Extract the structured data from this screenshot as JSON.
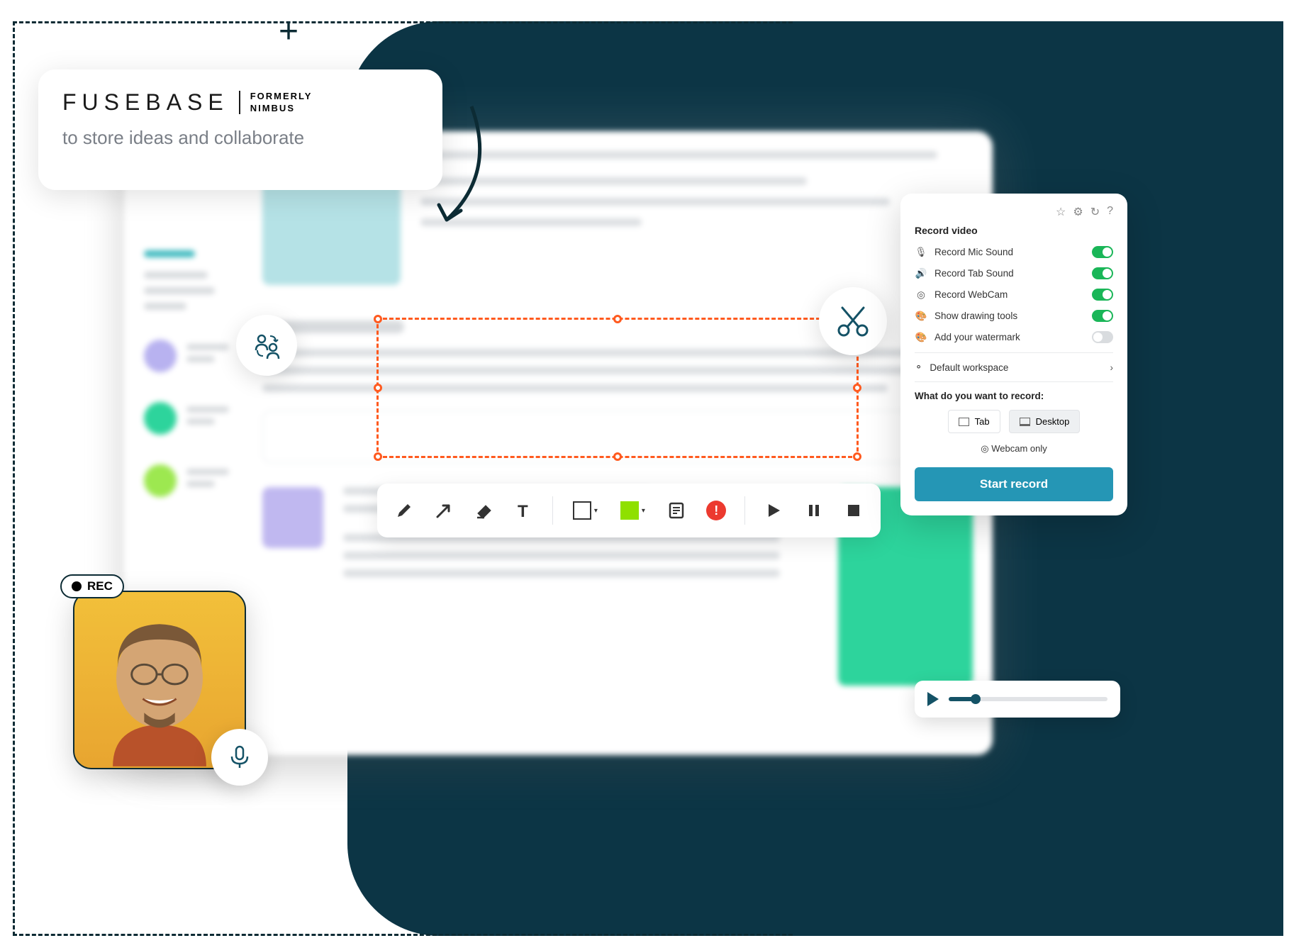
{
  "fusebase": {
    "name": "FUSEBASE",
    "formerly_line1": "FORMERLY",
    "formerly_line2": "NIMBUS",
    "tagline": "to store ideas and collaborate"
  },
  "rec_badge": "REC",
  "record_panel": {
    "title": "Record video",
    "opts": {
      "mic": "Record Mic Sound",
      "tab": "Record Tab Sound",
      "webcam": "Record WebCam",
      "drawing": "Show drawing tools",
      "watermark": "Add your watermark"
    },
    "workspace": "Default workspace",
    "sub_title": "What do you want to record:",
    "mode_tab": "Tab",
    "mode_desktop": "Desktop",
    "webcam_only": "Webcam only",
    "start": "Start record"
  },
  "colors": {
    "accent_teal": "#40bac0",
    "orange": "#ff5a1f",
    "green_toggle": "#1ab658",
    "blue_btn": "#2596b5"
  }
}
